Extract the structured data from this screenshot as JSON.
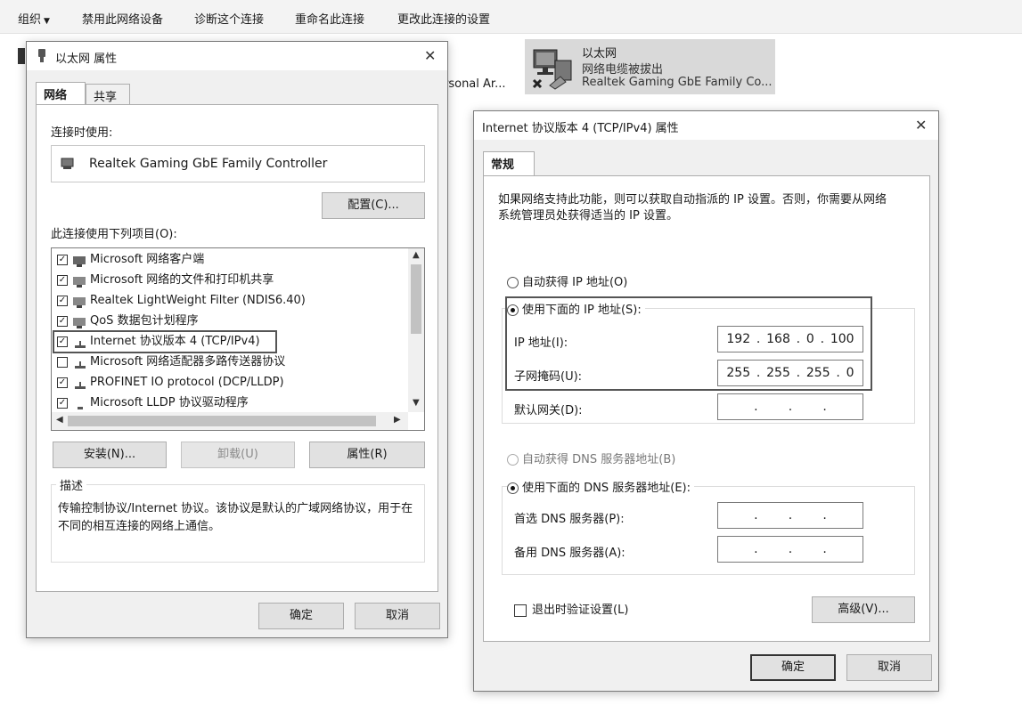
{
  "cmdbar": {
    "organize": "组织",
    "disable": "禁用此网络设备",
    "diagnose": "诊断这个连接",
    "rename": "重命名此连接",
    "change_settings": "更改此连接的设置"
  },
  "background": {
    "partial_text": "rsonal Ar...",
    "adapter": {
      "name": "以太网",
      "status": "网络电缆被拔出",
      "device": "Realtek Gaming GbE Family Co..."
    }
  },
  "eth_dialog": {
    "title": "以太网 属性",
    "tabs": [
      "网络",
      "共享"
    ],
    "connect_using_label": "连接时使用:",
    "adapter_name": "Realtek Gaming GbE Family Controller",
    "configure_button": "配置(C)...",
    "items_label": "此连接使用下列项目(O):",
    "items": [
      {
        "label": "Microsoft 网络客户端",
        "checked": true,
        "icon": "network-client-icon"
      },
      {
        "label": "Microsoft 网络的文件和打印机共享",
        "checked": true,
        "icon": "file-share-icon"
      },
      {
        "label": "Realtek LightWeight Filter (NDIS6.40)",
        "checked": true,
        "icon": "filter-service-icon"
      },
      {
        "label": "QoS 数据包计划程序",
        "checked": true,
        "icon": "qos-icon"
      },
      {
        "label": "Internet 协议版本 4 (TCP/IPv4)",
        "checked": true,
        "icon": "protocol-icon"
      },
      {
        "label": "Microsoft 网络适配器多路传送器协议",
        "checked": false,
        "icon": "protocol-icon"
      },
      {
        "label": "PROFINET IO protocol (DCP/LLDP)",
        "checked": true,
        "icon": "protocol-icon"
      },
      {
        "label": "Microsoft LLDP 协议驱动程序",
        "checked": true,
        "icon": "protocol-icon"
      }
    ],
    "install_button": "安装(N)...",
    "uninstall_button": "卸载(U)",
    "properties_button": "属性(R)",
    "description_label": "描述",
    "description_text": "传输控制协议/Internet 协议。该协议是默认的广域网络协议，用于在不同的相互连接的网络上通信。",
    "ok_button": "确定",
    "cancel_button": "取消"
  },
  "ipv4_dialog": {
    "title": "Internet 协议版本 4 (TCP/IPv4) 属性",
    "tab": "常规",
    "intro": "如果网络支持此功能，则可以获取自动指派的 IP 设置。否则，你需要从网络系统管理员处获得适当的 IP 设置。",
    "auto_ip": "自动获得 IP 地址(O)",
    "manual_ip": "使用下面的 IP 地址(S):",
    "ip_label": "IP 地址(I):",
    "ip_value": [
      "192",
      "168",
      "0",
      "100"
    ],
    "mask_label": "子网掩码(U):",
    "mask_value": [
      "255",
      "255",
      "255",
      "0"
    ],
    "gateway_label": "默认网关(D):",
    "auto_dns": "自动获得 DNS 服务器地址(B)",
    "manual_dns": "使用下面的 DNS 服务器地址(E):",
    "dns1_label": "首选 DNS 服务器(P):",
    "dns2_label": "备用 DNS 服务器(A):",
    "validate_label": "退出时验证设置(L)",
    "advanced_button": "高级(V)...",
    "ok_button": "确定",
    "cancel_button": "取消"
  }
}
